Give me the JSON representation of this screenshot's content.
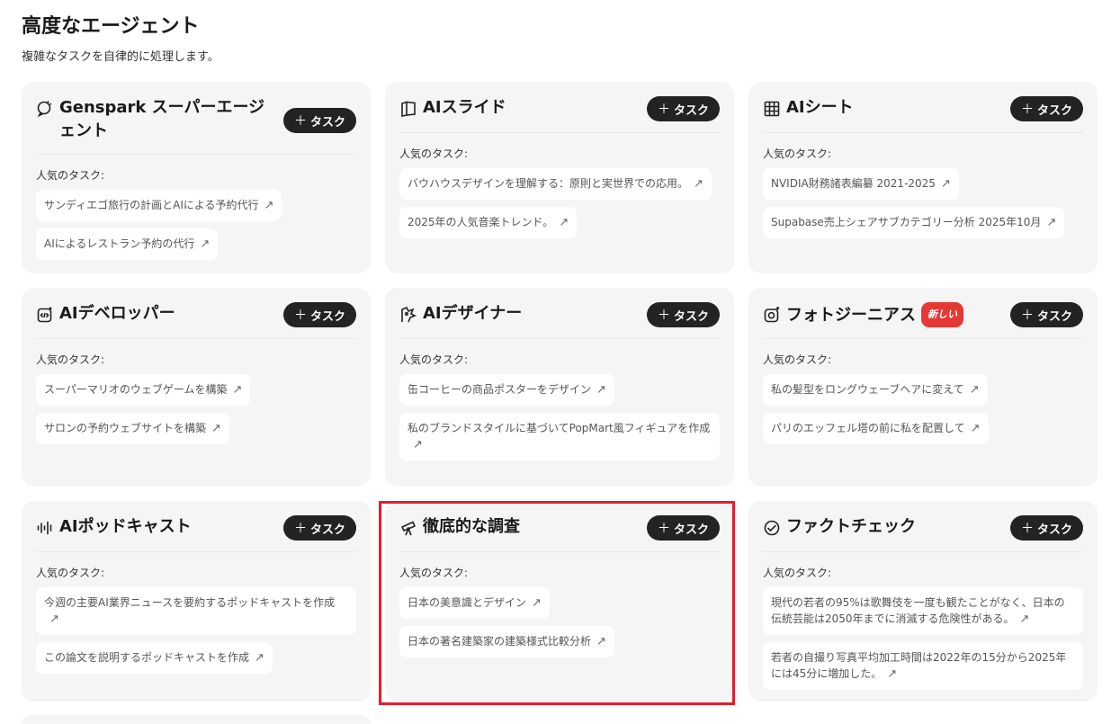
{
  "header": {
    "title": "高度なエージェント",
    "subtitle": "複雑なタスクを自律的に処理します。"
  },
  "common": {
    "task_button": "タスク",
    "popular_label": "人気のタスク:",
    "new_badge": "新しい"
  },
  "cards": [
    {
      "title": "Genspark スーパーエージェント",
      "icon": "chat-bubble-icon",
      "tasks": [
        "サンディエゴ旅行の計画とAIによる予約代行",
        "AIによるレストラン予約の代行"
      ]
    },
    {
      "title": "AIスライド",
      "icon": "slides-icon",
      "tasks": [
        "バウハウスデザインを理解する：原則と実世界での応用。",
        "2025年の人気音楽トレンド。"
      ]
    },
    {
      "title": "AIシート",
      "icon": "table-grid-icon",
      "tasks": [
        "NVIDIA財務諸表編纂 2021-2025",
        "Supabase売上シェアサブカテゴリー分析 2025年10月"
      ]
    },
    {
      "title": "AIデベロッパー",
      "icon": "code-icon",
      "tasks": [
        "スーパーマリオのウェブゲームを構築",
        "サロンの予約ウェブサイトを構築"
      ]
    },
    {
      "title": "AIデザイナー",
      "icon": "designer-icon",
      "tasks": [
        "缶コーヒーの商品ポスターをデザイン",
        "私のブランドスタイルに基づいてPopMart風フィギュアを作成"
      ]
    },
    {
      "title": "フォトジーニアス",
      "icon": "camera-sparkle-icon",
      "badge": true,
      "tasks": [
        "私の髪型をロングウェーブヘアに変えて",
        "パリのエッフェル塔の前に私を配置して"
      ]
    },
    {
      "title": "AIポッドキャスト",
      "icon": "audio-wave-icon",
      "tasks": [
        "今週の主要AI業界ニュースを要約するポッドキャストを作成",
        "この論文を説明するポッドキャストを作成"
      ]
    },
    {
      "title": "徹底的な調査",
      "icon": "telescope-icon",
      "tasks": [
        "日本の美意識とデザイン",
        "日本の著名建築家の建築様式比較分析"
      ]
    },
    {
      "title": "ファクトチェック",
      "icon": "check-circle-icon",
      "tasks": [
        "現代の若者の95%は歌舞伎を一度も観たことがなく、日本の伝統芸能は2050年までに消滅する危険性がある。",
        "若者の自撮り写真平均加工時間は2022年の15分から2025年には45分に増加した。"
      ]
    }
  ]
}
